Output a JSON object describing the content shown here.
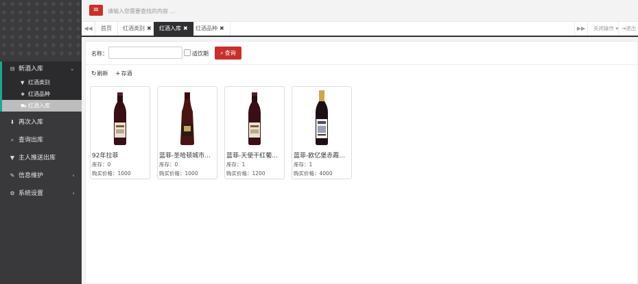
{
  "colors": {
    "accent_red": "#c9302c",
    "sidebar_bg": "#39393b",
    "active_border": "#19aa8d"
  },
  "sidebar": {
    "items": [
      {
        "label": "新酒入库",
        "icon": "minus-square-icon",
        "expanded": true
      },
      {
        "label": "再次入库",
        "icon": "download-icon"
      },
      {
        "label": "查询出库",
        "icon": "search-icon"
      },
      {
        "label": "主人推送出库",
        "icon": "filter-icon"
      },
      {
        "label": "信息维护",
        "icon": "edit-icon"
      },
      {
        "label": "系统设置",
        "icon": "gear-icon"
      }
    ],
    "submenu": [
      {
        "label": "红酒类别",
        "icon": "filter-icon"
      },
      {
        "label": "红酒品种",
        "icon": "cubes-icon"
      },
      {
        "label": "红酒入库",
        "icon": "cart-icon",
        "selected": true
      }
    ]
  },
  "topbar": {
    "search_placeholder": "请输入您需要查找的内容 ..."
  },
  "tabs": [
    {
      "label": "首页"
    },
    {
      "label": "红酒类别"
    },
    {
      "label": "红酒入库",
      "active": true
    },
    {
      "label": "红酒品种"
    }
  ],
  "tabbar": {
    "close_ops": "关闭操作",
    "logout": "退出"
  },
  "filter": {
    "name_label": "名称：",
    "name_value": "",
    "expired_label": "适饮期",
    "query_label": "查询"
  },
  "actions": {
    "refresh": "刷新",
    "store": "存酒"
  },
  "products": [
    {
      "name": "92年拉菲",
      "stock": "库存：0",
      "price": "购买价格：1000"
    },
    {
      "name": "蓝菲-圣哈顿城市...",
      "stock": "库存：0",
      "price": "购买价格：1000"
    },
    {
      "name": "蓝菲-天使干红葡...",
      "stock": "库存：1",
      "price": "购买价格：1200"
    },
    {
      "name": "蓝菲-欧亿堡赤霞...",
      "stock": "库存：1",
      "price": "购买价格：4000"
    }
  ]
}
